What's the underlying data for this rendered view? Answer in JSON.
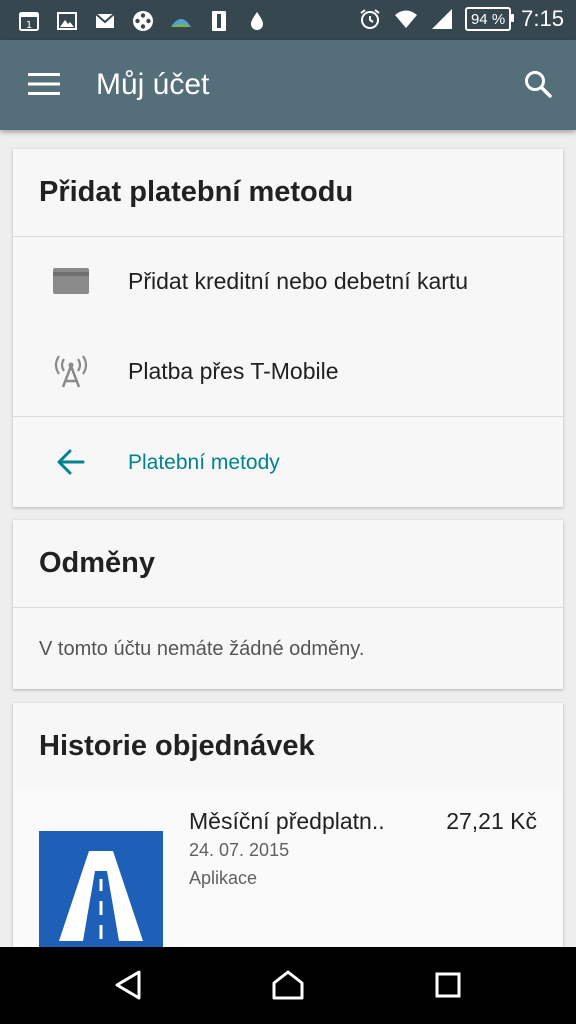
{
  "status_bar": {
    "left_icons": [
      "calendar-icon",
      "image-icon",
      "mail-icon",
      "film-reel-icon",
      "landscape-icon",
      "portrait-icon",
      "water-drop-icon"
    ],
    "calendar_day": "1",
    "right_icons": [
      "alarm-icon",
      "wifi-icon",
      "signal-icon"
    ],
    "battery": "94 %",
    "time": "7:15"
  },
  "app_bar": {
    "title": "Můj účet",
    "menu_icon": "menu-icon",
    "search_icon": "search-icon",
    "background": "#546e7a"
  },
  "payment_card": {
    "title": "Přidat platební metodu",
    "items": [
      {
        "icon": "credit-card-icon",
        "label": "Přidat kreditní nebo debetní kartu"
      },
      {
        "icon": "antenna-icon",
        "label": "Platba přes T-Mobile"
      }
    ],
    "back_link": {
      "icon": "arrow-back-icon",
      "label": "Platební metody",
      "color": "#00838f"
    }
  },
  "rewards_card": {
    "title": "Odměny",
    "message": "V tomto účtu nemáte žádné odměny."
  },
  "orders_card": {
    "title": "Historie objednávek",
    "orders": [
      {
        "name": "Měsíční předplatn..",
        "price": "27,21 Kč",
        "date": "24. 07. 2015",
        "type": "Aplikace",
        "thumb_icon": "road-app-icon",
        "thumb_color": "#1e5fb8"
      }
    ]
  },
  "nav_bar": {
    "buttons": [
      "back-triangle-icon",
      "home-icon",
      "recents-icon"
    ]
  }
}
